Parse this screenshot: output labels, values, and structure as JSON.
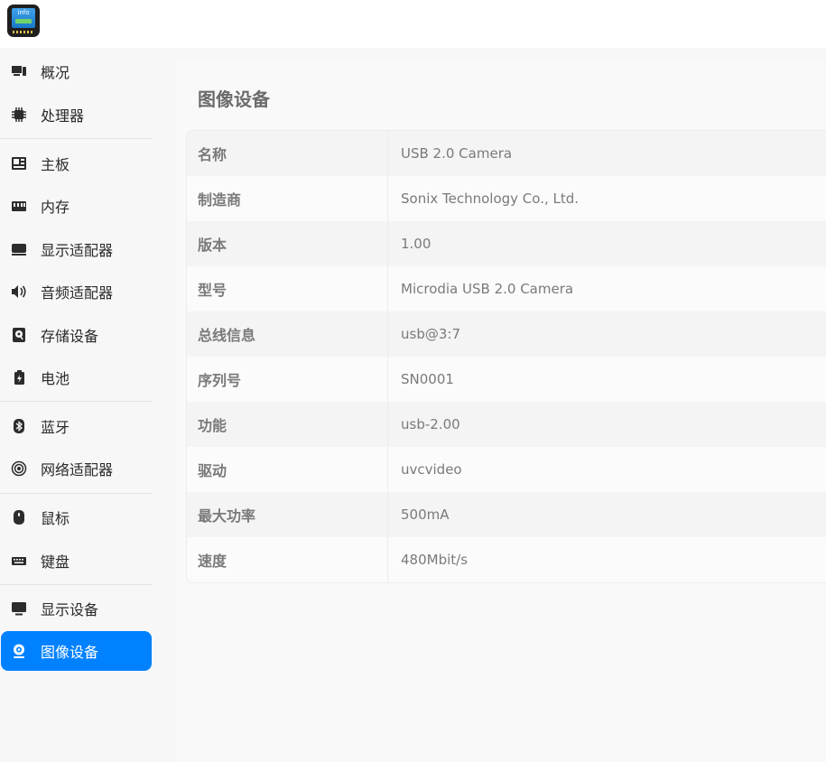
{
  "app": {
    "icon_label": "info"
  },
  "sidebar": {
    "items": [
      {
        "label": "概况",
        "icon": "overview-icon"
      },
      {
        "label": "处理器",
        "icon": "cpu-icon"
      },
      {
        "label": "主板",
        "icon": "motherboard-icon"
      },
      {
        "label": "内存",
        "icon": "memory-icon"
      },
      {
        "label": "显示适配器",
        "icon": "gpu-icon"
      },
      {
        "label": "音频适配器",
        "icon": "speaker-icon"
      },
      {
        "label": "存储设备",
        "icon": "storage-icon"
      },
      {
        "label": "电池",
        "icon": "battery-icon"
      },
      {
        "label": "蓝牙",
        "icon": "bluetooth-icon"
      },
      {
        "label": "网络适配器",
        "icon": "network-icon"
      },
      {
        "label": "鼠标",
        "icon": "mouse-icon"
      },
      {
        "label": "键盘",
        "icon": "keyboard-icon"
      },
      {
        "label": "显示设备",
        "icon": "monitor-icon"
      },
      {
        "label": "图像设备",
        "icon": "camera-icon",
        "active": true
      }
    ]
  },
  "main": {
    "title": "图像设备",
    "rows": [
      {
        "key": "名称",
        "value": "USB 2.0 Camera"
      },
      {
        "key": "制造商",
        "value": "Sonix Technology Co., Ltd."
      },
      {
        "key": "版本",
        "value": "1.00"
      },
      {
        "key": "型号",
        "value": "Microdia USB 2.0 Camera"
      },
      {
        "key": "总线信息",
        "value": "usb@3:7"
      },
      {
        "key": "序列号",
        "value": "SN0001"
      },
      {
        "key": "功能",
        "value": "usb-2.00"
      },
      {
        "key": "驱动",
        "value": "uvcvideo"
      },
      {
        "key": "最大功率",
        "value": "500mA"
      },
      {
        "key": "速度",
        "value": "480Mbit/s"
      }
    ]
  },
  "colors": {
    "accent": "#0081ff",
    "sidebar_bg": "#f7f7f8",
    "text_secondary": "#7a7a7a"
  }
}
